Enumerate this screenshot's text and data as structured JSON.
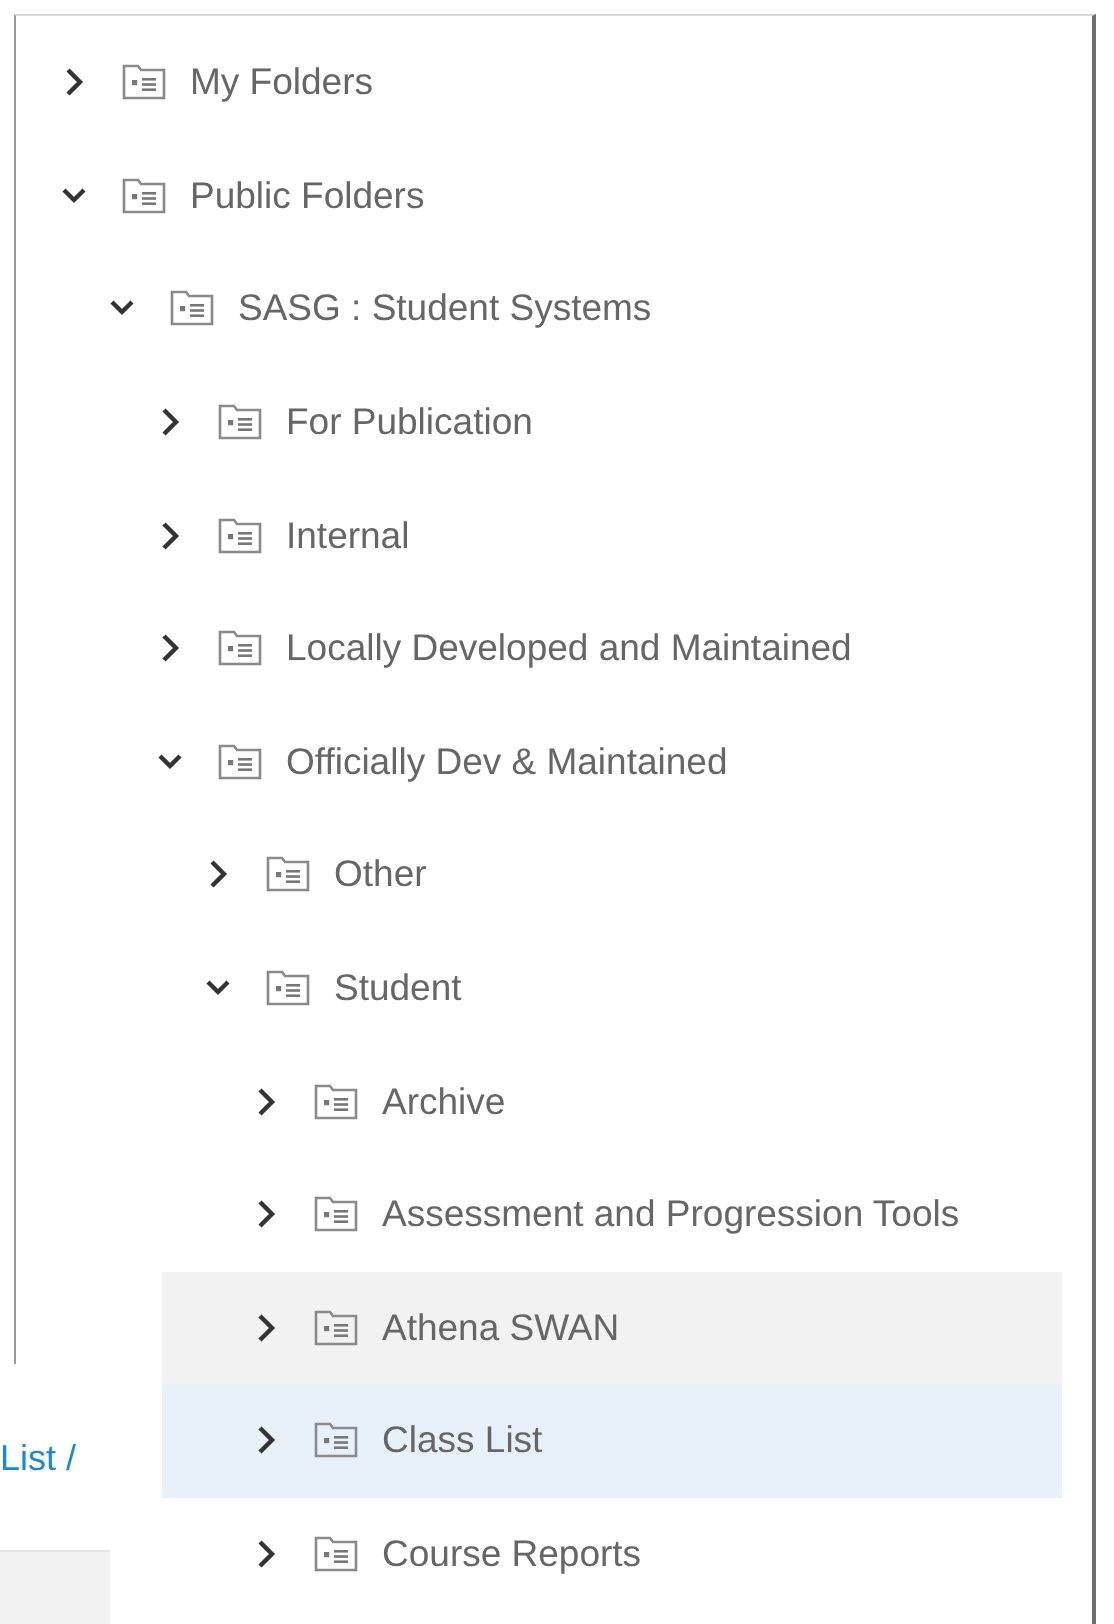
{
  "tree": [
    {
      "label": "My Folders",
      "expanded": false,
      "selected": false,
      "hovered": false
    },
    {
      "label": "Public Folders",
      "expanded": true,
      "selected": false,
      "hovered": false,
      "children": [
        {
          "label": "SASG : Student Systems",
          "expanded": true,
          "selected": false,
          "hovered": false,
          "children": [
            {
              "label": "For Publication",
              "expanded": false,
              "selected": false,
              "hovered": false
            },
            {
              "label": "Internal",
              "expanded": false,
              "selected": false,
              "hovered": false
            },
            {
              "label": "Locally Developed and Maintained",
              "expanded": false,
              "selected": false,
              "hovered": false
            },
            {
              "label": "Officially Dev & Maintained",
              "expanded": true,
              "selected": false,
              "hovered": false,
              "children": [
                {
                  "label": "Other",
                  "expanded": false,
                  "selected": false,
                  "hovered": false
                },
                {
                  "label": "Student",
                  "expanded": true,
                  "selected": false,
                  "hovered": false,
                  "children": [
                    {
                      "label": "Archive",
                      "expanded": false,
                      "selected": false,
                      "hovered": false
                    },
                    {
                      "label": "Assessment and Progression Tools",
                      "expanded": false,
                      "selected": false,
                      "hovered": false
                    },
                    {
                      "label": "Athena SWAN",
                      "expanded": false,
                      "selected": false,
                      "hovered": true
                    },
                    {
                      "label": "Class List",
                      "expanded": false,
                      "selected": true,
                      "hovered": false
                    },
                    {
                      "label": "Course Reports",
                      "expanded": false,
                      "selected": false,
                      "hovered": false
                    }
                  ]
                }
              ]
            }
          ]
        }
      ]
    }
  ],
  "breadcrumb": {
    "link": "List",
    "separator": "/"
  }
}
